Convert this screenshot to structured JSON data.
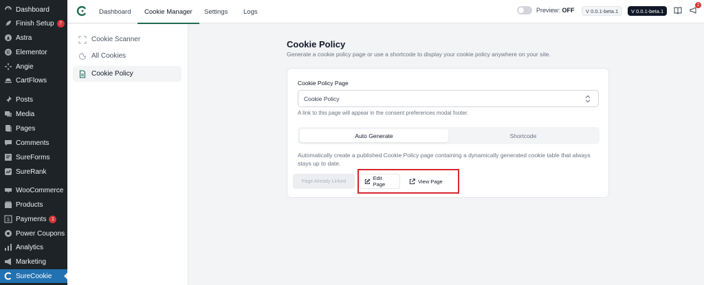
{
  "wp_menu": [
    {
      "label": "Dashboard",
      "icon": "dashboard-icon"
    },
    {
      "label": "Finish Setup",
      "icon": "rocket-icon",
      "badge": "7"
    },
    {
      "label": "Astra",
      "icon": "astra-icon"
    },
    {
      "label": "Elementor",
      "icon": "elementor-icon"
    },
    {
      "label": "Angie",
      "icon": "angie-icon"
    },
    {
      "label": "CartFlows",
      "icon": "cartflows-icon"
    },
    {
      "label": "Posts",
      "icon": "pin-icon"
    },
    {
      "label": "Media",
      "icon": "media-icon"
    },
    {
      "label": "Pages",
      "icon": "pages-icon"
    },
    {
      "label": "Comments",
      "icon": "comment-icon"
    },
    {
      "label": "SureForms",
      "icon": "sureforms-icon"
    },
    {
      "label": "SureRank",
      "icon": "surerank-icon"
    },
    {
      "label": "WooCommerce",
      "icon": "woocommerce-icon"
    },
    {
      "label": "Products",
      "icon": "products-icon"
    },
    {
      "label": "Payments",
      "icon": "payments-icon",
      "badge": "1"
    },
    {
      "label": "Power Coupons",
      "icon": "coupon-icon"
    },
    {
      "label": "Analytics",
      "icon": "analytics-icon"
    },
    {
      "label": "Marketing",
      "icon": "megaphone-icon"
    },
    {
      "label": "SureCookie",
      "icon": "surecookie-icon"
    }
  ],
  "topbar": {
    "tabs": [
      "Dashboard",
      "Cookie Manager",
      "Settings",
      "Logs"
    ],
    "preview_label": "Preview:",
    "preview_state": "OFF",
    "version_plugin": "V 0.0.1-beta.1",
    "version_pro": "V 0.0.1-beta.1",
    "notification_count": "2"
  },
  "plugin_nav": [
    {
      "label": "Cookie Scanner",
      "icon": "scanner-icon"
    },
    {
      "label": "All Cookies",
      "icon": "cookie-icon"
    },
    {
      "label": "Cookie Policy",
      "icon": "document-icon"
    }
  ],
  "main": {
    "title": "Cookie Policy",
    "description": "Generate a cookie policy page or use a shortcode to display your cookie policy anywhere on your site.",
    "field_label": "Cookie Policy Page",
    "select_value": "Cookie Policy",
    "help_text": "A link to this page will appear in the consent preferences modal footer.",
    "segments": [
      "Auto Generate",
      "Shortcode"
    ],
    "auto_description": "Automatically create a published Cookie Policy page containing a dynamically generated cookie table that always stays up to date.",
    "btn_linked": "Page Already Linked",
    "btn_edit": "Edit Page",
    "btn_view": "View Page"
  },
  "colors": {
    "brand": "#1e6b52",
    "wp_sidebar": "#1d2327",
    "wp_active": "#2271b1",
    "highlight": "#d6262e"
  }
}
